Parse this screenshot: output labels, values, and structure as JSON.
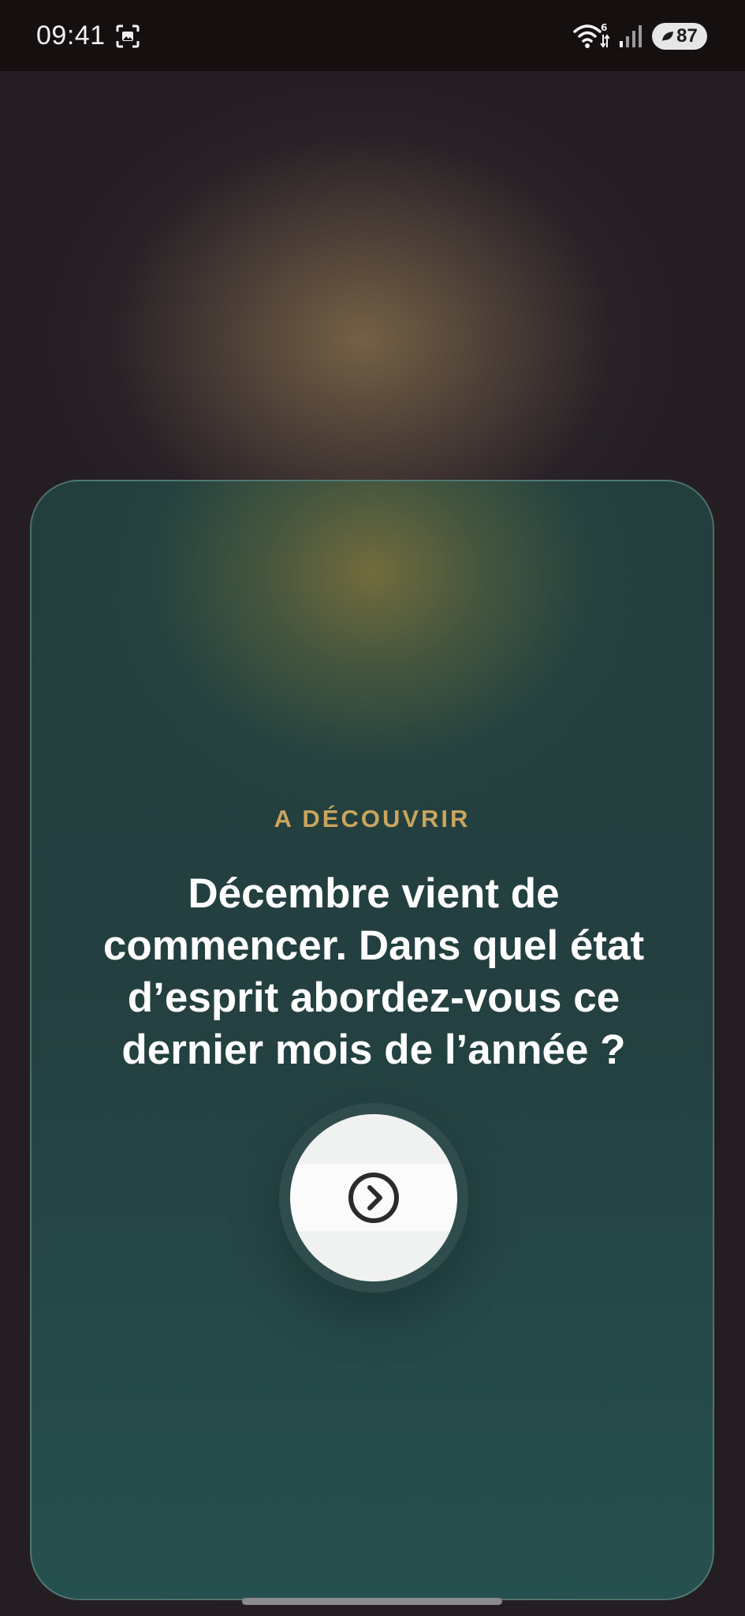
{
  "status_bar": {
    "time": "09:41",
    "wifi_badge": "6",
    "battery_level": "87",
    "icons": [
      "screenshot-icon",
      "wifi-icon",
      "signal-icon",
      "battery-leaf-icon"
    ]
  },
  "card": {
    "eyebrow": "A DÉCOUVRIR",
    "question": "Décembre vient de commencer. Dans quel état d’esprit abordez-vous ce dernier mois de l’année ?",
    "next_icon": "chevron-right-circle-icon"
  },
  "colors": {
    "eyebrow": "#c9a55e",
    "card_bg": "#243f3f",
    "page_bg": "#241e23",
    "button_bg": "#f7f7f7"
  }
}
